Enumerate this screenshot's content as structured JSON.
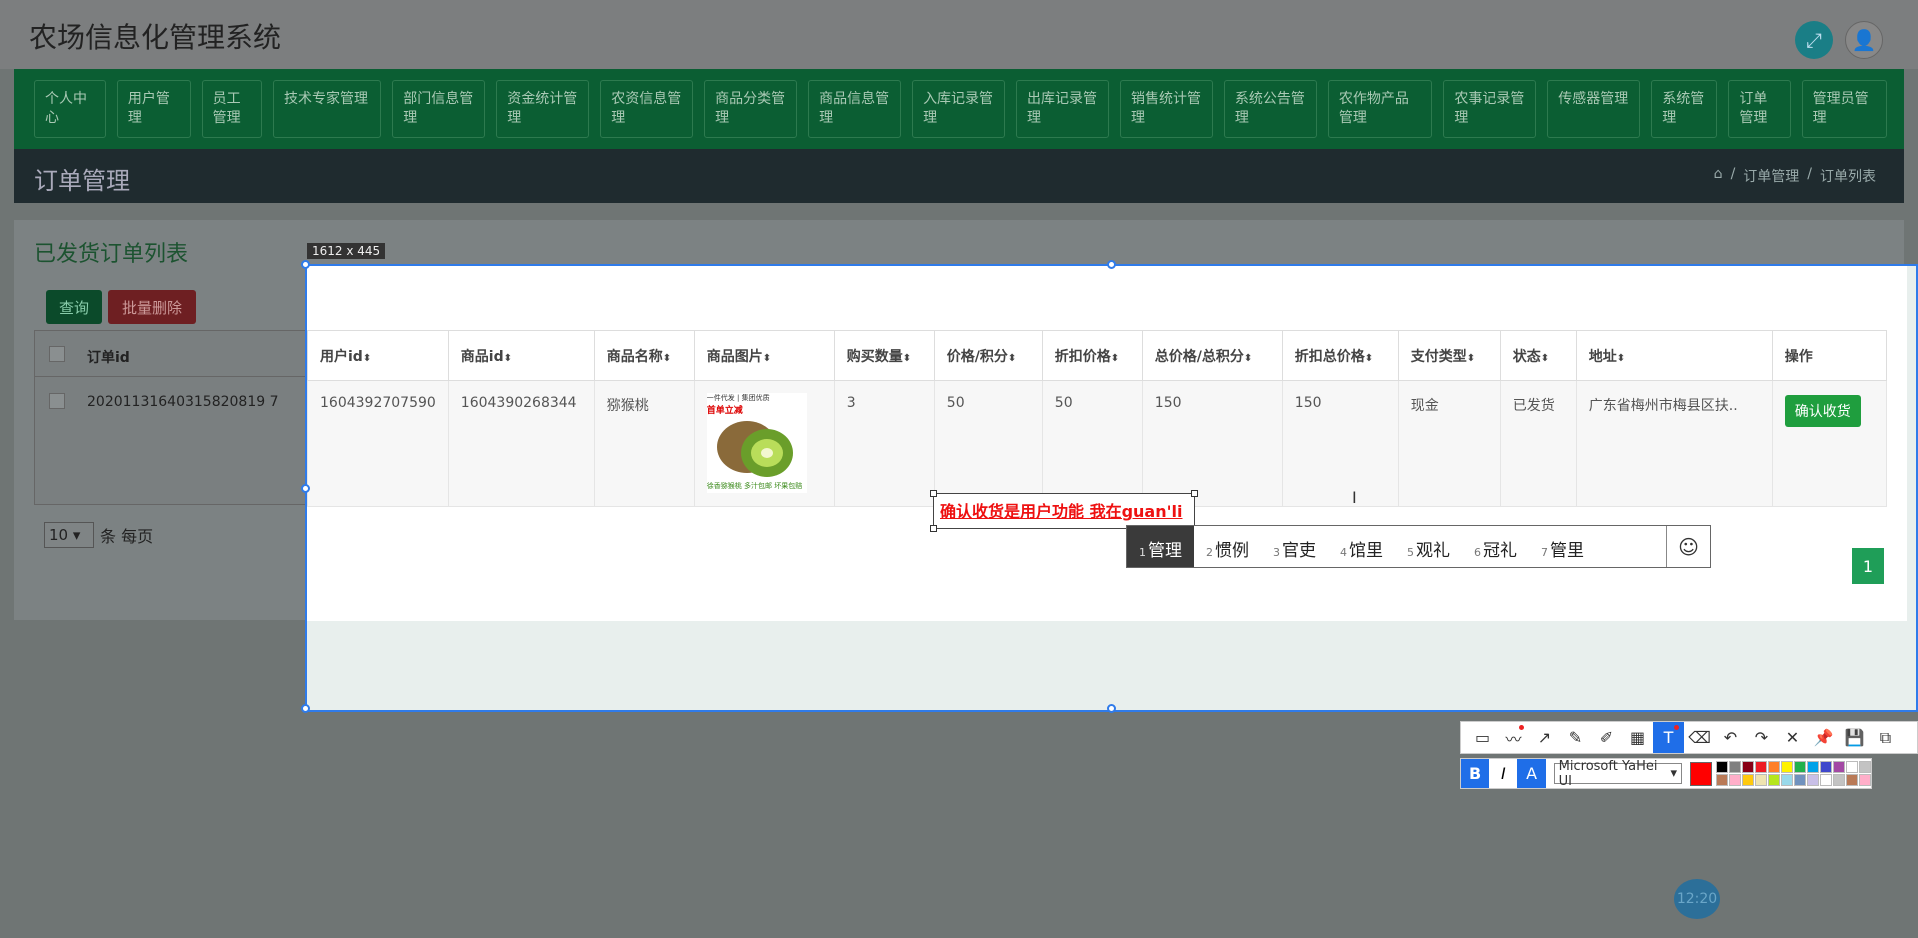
{
  "app_title": "农场信息化管理系统",
  "nav": [
    "个人中心",
    "用户管理",
    "员工管理",
    "技术专家管理",
    "部门信息管理",
    "资金统计管理",
    "农资信息管理",
    "商品分类管理",
    "商品信息管理",
    "入库记录管理",
    "出库记录管理",
    "销售统计管理",
    "系统公告管理",
    "农作物产品管理",
    "农事记录管理",
    "传感器管理",
    "系统管理",
    "订单管理",
    "管理员管理"
  ],
  "page": {
    "title": "订单管理",
    "breadcrumb": [
      "订单管理",
      "订单列表"
    ]
  },
  "panel": {
    "title": "已发货订单列表",
    "query_label": "查询",
    "batch_delete_label": "批量删除",
    "order_id_header": "订单id",
    "order_id": "20201131640315820819 7",
    "per_page_value": "10",
    "per_page_suffix": "条 每页"
  },
  "selection_size": "1612 x 445",
  "table": {
    "headers": [
      "用户id",
      "商品id",
      "商品名称",
      "商品图片",
      "购买数量",
      "价格/积分",
      "折扣价格",
      "总价格/总积分",
      "折扣总价格",
      "支付类型",
      "状态",
      "地址",
      "操作"
    ],
    "row": {
      "user_id": "1604392707590",
      "product_id": "1604390268344",
      "product_name": "猕猴桃",
      "image_banner": "一件代发 | 集团优质",
      "image_tag": "首单立减",
      "image_caption": "徐香猕猴桃 多汁包邮 坏果包赔",
      "quantity": "3",
      "price": "50",
      "discount_price": "50",
      "total_price": "150",
      "discount_total": "150",
      "pay_type": "现金",
      "status": "已发货",
      "address": "广东省梅州市梅县区扶..",
      "action_label": "确认收货"
    },
    "page_number": "1"
  },
  "annotation_text": "确认收货是用户功能 我在guan'li",
  "ime_candidates": [
    {
      "n": "1",
      "text": "管理"
    },
    {
      "n": "2",
      "text": "惯例"
    },
    {
      "n": "3",
      "text": "官吏"
    },
    {
      "n": "4",
      "text": "馆里"
    },
    {
      "n": "5",
      "text": "观礼"
    },
    {
      "n": "6",
      "text": "冠礼"
    },
    {
      "n": "7",
      "text": "管里"
    }
  ],
  "toolbar": {
    "font_name": "Microsoft YaHei UI",
    "bold_label": "B",
    "italic_label": "I",
    "outline_label": "A",
    "text_tool_label": "T"
  },
  "palette": [
    "#000000",
    "#7f7f7f",
    "#880015",
    "#ed1c24",
    "#ff7f27",
    "#fff200",
    "#22b14c",
    "#00a2e8",
    "#3f48cc",
    "#a349a4",
    "#ffffff",
    "#c3c3c3",
    "#b97a57",
    "#ffaec9",
    "#ffc90e",
    "#efe4b0",
    "#b5e61d",
    "#99d9ea",
    "#7092be",
    "#c8bfe7",
    "#ffffff",
    "#c3c3c3",
    "#b97a57",
    "#ffaec9"
  ],
  "clock": "12:20"
}
